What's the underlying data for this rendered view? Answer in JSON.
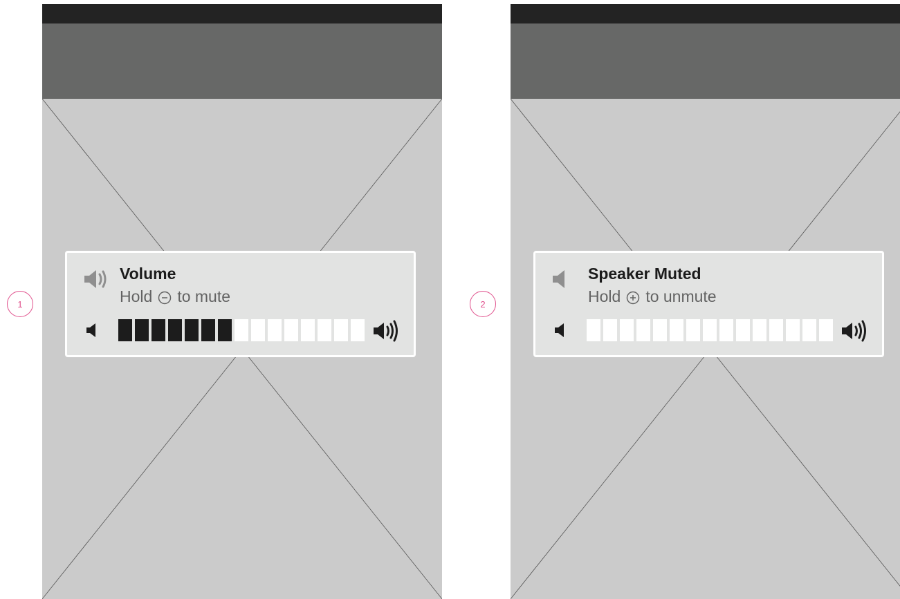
{
  "colors": {
    "accent_badge": "#e0508c",
    "status_bar": "#232323",
    "header_bar": "#676867",
    "screen_bg": "#cbcbcb",
    "hud_bg": "#e2e3e2",
    "segment_filled": "#1c1c1c",
    "segment_empty": "#ffffff"
  },
  "screens": [
    {
      "step": "1",
      "hud": {
        "icon": "speaker-sound-icon",
        "title": "Volume",
        "subtitle_hold": "Hold",
        "subtitle_glyph": "minus-circle-icon",
        "subtitle_action": "to mute",
        "low_icon": "speaker-low-icon",
        "high_icon": "speaker-high-icon",
        "volume": {
          "level": 7,
          "max": 15
        }
      }
    },
    {
      "step": "2",
      "hud": {
        "icon": "speaker-muted-icon",
        "title": "Speaker Muted",
        "subtitle_hold": "Hold",
        "subtitle_glyph": "plus-circle-icon",
        "subtitle_action": "to unmute",
        "low_icon": "speaker-low-icon",
        "high_icon": "speaker-high-icon",
        "volume": {
          "level": 0,
          "max": 15
        }
      }
    }
  ]
}
